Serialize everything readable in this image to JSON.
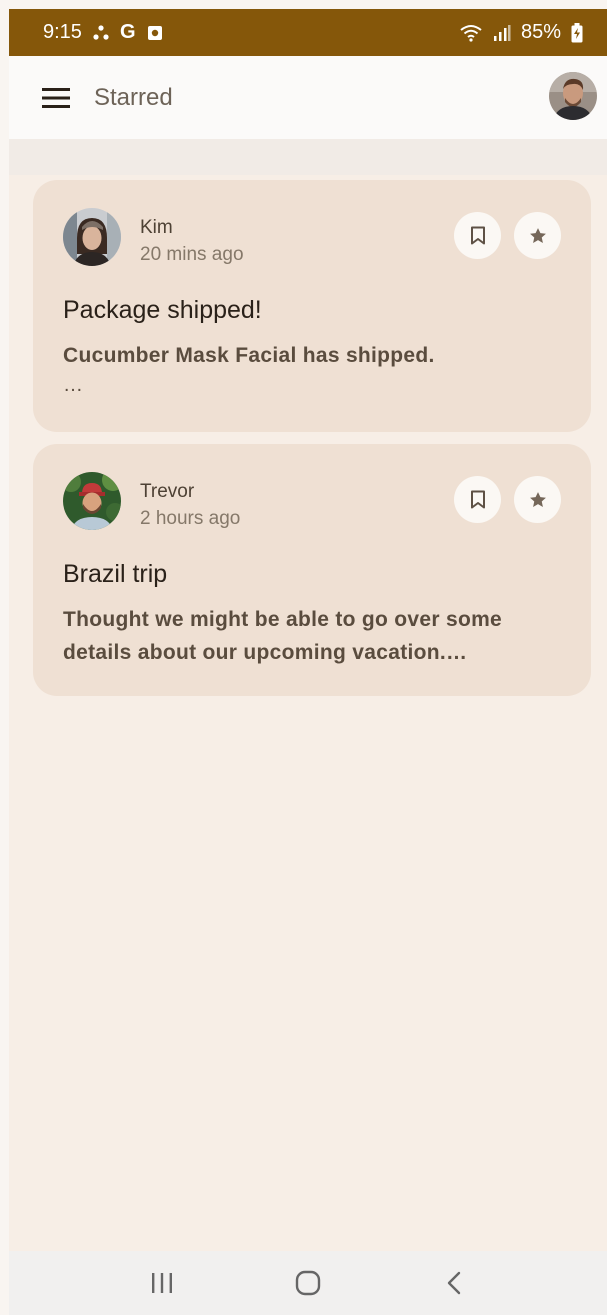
{
  "status_bar": {
    "time": "9:15",
    "notification_icons": [
      "share-icon",
      "google-icon",
      "photo-icon"
    ],
    "g_glyph": "G",
    "battery": "85%",
    "right_icons": [
      "wifi-icon",
      "signal-icon",
      "battery-charging-icon"
    ]
  },
  "app_bar": {
    "title": "Starred",
    "menu_icon": "menu-icon",
    "account_icon": "account-avatar"
  },
  "emails": [
    {
      "sender": "Kim",
      "time": "20 mins ago",
      "subject": "Package shipped!",
      "preview": "Cucumber Mask Facial has shipped.",
      "preview_more": "…",
      "actions": [
        "bookmark-icon",
        "star-icon"
      ]
    },
    {
      "sender": "Trevor",
      "time": "2 hours ago",
      "subject": "Brazil trip",
      "preview": "Thought we might be able to go over some details about our upcoming vacation.…",
      "actions": [
        "bookmark-icon",
        "star-icon"
      ]
    }
  ],
  "nav_bar": {
    "buttons": [
      "recents-icon",
      "home-icon",
      "back-icon"
    ]
  },
  "colors": {
    "status_bar": "#85570a",
    "app_bar": "#fbfaf9",
    "background": "#f7eee6",
    "card": "#efe0d3",
    "icon_button": "#fbf8f4"
  }
}
